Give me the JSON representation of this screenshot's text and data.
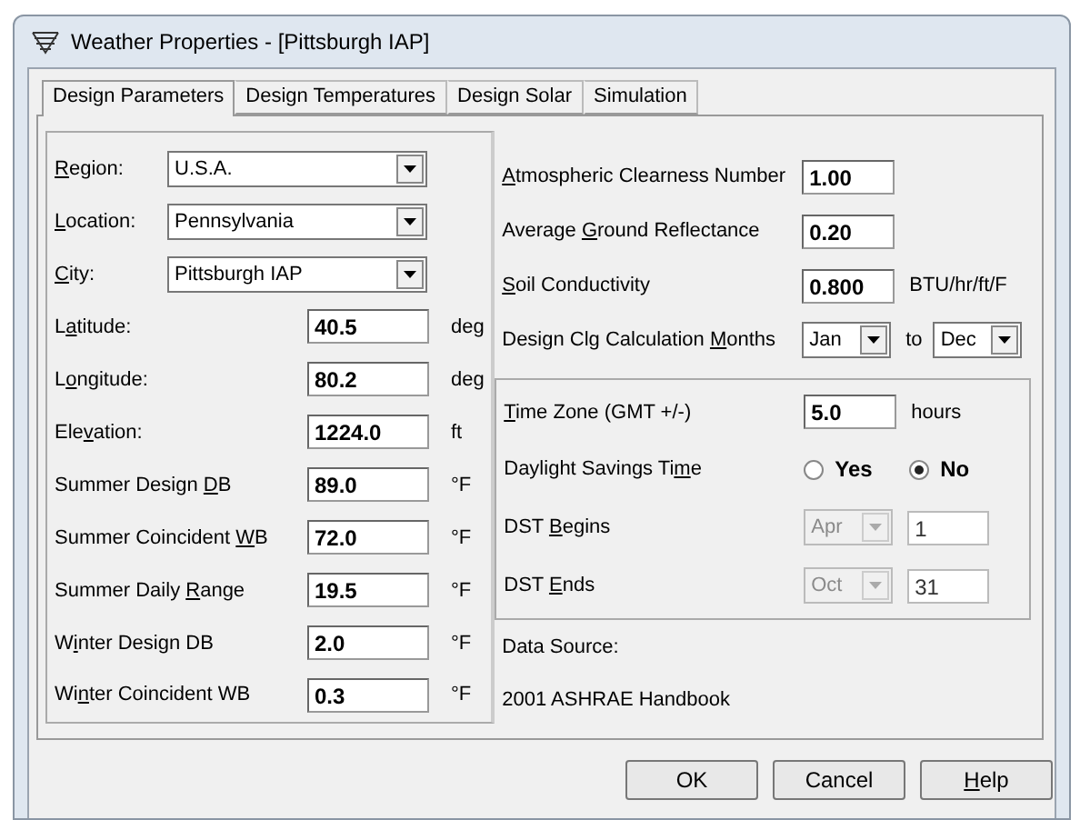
{
  "window": {
    "title": "Weather Properties - [Pittsburgh IAP]"
  },
  "tabs": [
    {
      "label": "Design Parameters",
      "selected": true
    },
    {
      "label": "Design Temperatures",
      "selected": false
    },
    {
      "label": "Design Solar",
      "selected": false
    },
    {
      "label": "Simulation",
      "selected": false
    }
  ],
  "location_fields": [
    {
      "label": {
        "key": "R",
        "post": "egion:"
      },
      "value": "U.S.A."
    },
    {
      "label": {
        "key": "L",
        "post": "ocation:"
      },
      "value": "Pennsylvania"
    },
    {
      "label": {
        "key": "C",
        "post": "ity:"
      },
      "value": "Pittsburgh IAP"
    }
  ],
  "parameters": [
    {
      "label": {
        "pre": "L",
        "key": "a",
        "post": "titude:"
      },
      "value": "40.5",
      "unit": "deg"
    },
    {
      "label": {
        "pre": "L",
        "key": "o",
        "post": "ngitude:"
      },
      "value": "80.2",
      "unit": "deg"
    },
    {
      "label": {
        "pre": "Ele",
        "key": "v",
        "post": "ation:"
      },
      "value": "1224.0",
      "unit": "ft"
    },
    {
      "label": {
        "pre": "Summer Design ",
        "key": "D",
        "post": "B"
      },
      "value": "89.0",
      "unit": "°F"
    },
    {
      "label": {
        "pre": "Summer Coincident ",
        "key": "W",
        "post": "B"
      },
      "value": "72.0",
      "unit": "°F"
    },
    {
      "label": {
        "pre": "Summer Daily ",
        "key": "R",
        "post": "ange"
      },
      "value": "19.5",
      "unit": "°F"
    },
    {
      "label": {
        "pre": "W",
        "key": "i",
        "post": "nter Design DB"
      },
      "value": "2.0",
      "unit": "°F"
    },
    {
      "label": {
        "pre": "Wi",
        "key": "n",
        "post": "ter Coincident WB"
      },
      "value": "0.3",
      "unit": "°F"
    }
  ],
  "solar": [
    {
      "label": {
        "key": "A",
        "post": "tmospheric Clearness Number"
      },
      "value": "1.00"
    },
    {
      "label": {
        "pre": "Average ",
        "key": "G",
        "post": "round Reflectance"
      },
      "value": "0.20"
    },
    {
      "label": {
        "key": "S",
        "post": "oil Conductivity"
      },
      "value": "0.800",
      "unit": "BTU/hr/ft/F"
    }
  ],
  "months": {
    "label": {
      "pre": "Design Clg Calculation ",
      "key": "M",
      "post": "onths"
    },
    "from": "Jan",
    "to_label": "to",
    "to": "Dec"
  },
  "time_zone": {
    "label": {
      "key": "T",
      "post": "ime Zone (GMT +/-)"
    },
    "value": "5.0",
    "unit": "hours"
  },
  "dst": {
    "label": {
      "pre": "Daylight Savings Ti",
      "key": "m",
      "post": "e"
    },
    "options": [
      {
        "label": "Yes",
        "selected": false
      },
      {
        "label": "No",
        "selected": true
      }
    ]
  },
  "dst_dates": [
    {
      "label": {
        "pre": "DST ",
        "key": "B",
        "post": "egins"
      },
      "month": "Apr",
      "day": "1",
      "disabled": true
    },
    {
      "label": {
        "pre": "DST ",
        "key": "E",
        "post": "nds"
      },
      "month": "Oct",
      "day": "31",
      "disabled": true
    }
  ],
  "data_source": {
    "label": "Data Source:",
    "value": "2001 ASHRAE Handbook"
  },
  "buttons": [
    {
      "label": {
        "text": "OK"
      }
    },
    {
      "label": {
        "text": "Cancel"
      }
    },
    {
      "label": {
        "key": "H",
        "post": "elp"
      }
    }
  ]
}
